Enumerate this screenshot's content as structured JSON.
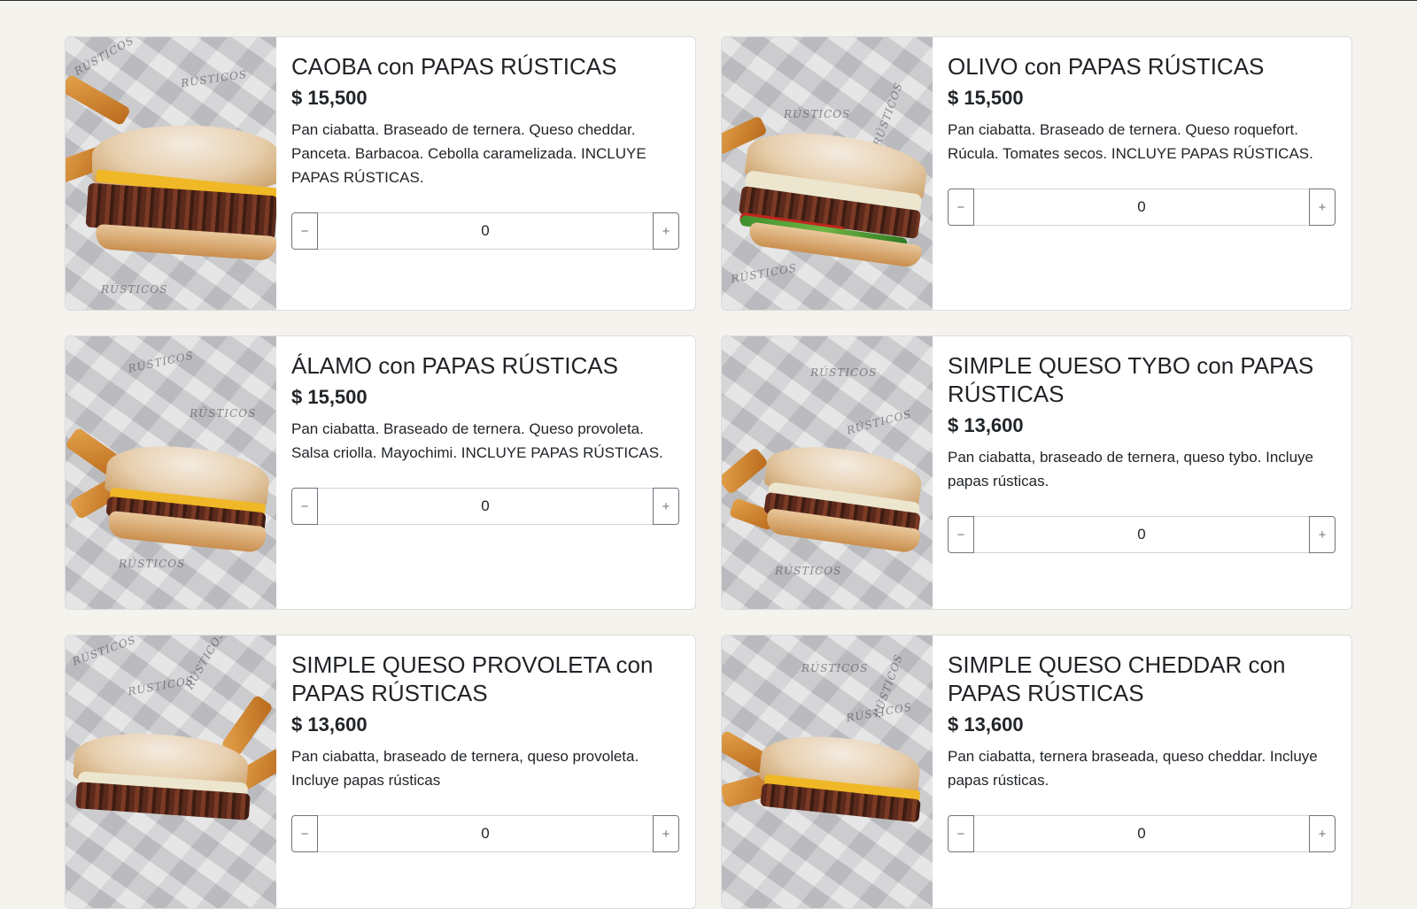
{
  "currency_symbol": "$",
  "products": [
    {
      "title": "CAOBA con PAPAS RÚSTICAS",
      "price": "$ 15,500",
      "description": "Pan ciabatta. Braseado de ternera. Queso cheddar. Panceta. Barbacoa. Cebolla caramelizada. INCLUYE PAPAS RÚSTICAS.",
      "quantity": "0",
      "minus_label": "−",
      "plus_label": "+"
    },
    {
      "title": "OLIVO con PAPAS RÚSTICAS",
      "price": "$ 15,500",
      "description": "Pan ciabatta. Braseado de ternera. Queso roquefort. Rúcula. Tomates secos. INCLUYE PAPAS RÚSTICAS.",
      "quantity": "0",
      "minus_label": "−",
      "plus_label": "+"
    },
    {
      "title": "ÁLAMO con PAPAS RÚSTICAS",
      "price": "$ 15,500",
      "description": "Pan ciabatta. Braseado de ternera. Queso provoleta. Salsa criolla. Mayochimi. INCLUYE PAPAS RÚSTICAS.",
      "quantity": "0",
      "minus_label": "−",
      "plus_label": "+"
    },
    {
      "title": "SIMPLE QUESO TYBO con PAPAS RÚSTICAS",
      "price": "$ 13,600",
      "description": "Pan ciabatta, braseado de ternera, queso tybo. Incluye papas rústicas.",
      "quantity": "0",
      "minus_label": "−",
      "plus_label": "+"
    },
    {
      "title": "SIMPLE QUESO PROVOLETA con PAPAS RÚSTICAS",
      "price": "$ 13,600",
      "description": "Pan ciabatta, braseado de ternera, queso provoleta. Incluye papas rústicas",
      "quantity": "0",
      "minus_label": "−",
      "plus_label": "+"
    },
    {
      "title": "SIMPLE QUESO CHEDDAR con PAPAS RÚSTICAS",
      "price": "$ 13,600",
      "description": "Pan ciabatta, ternera braseada, queso cheddar. Incluye papas rústicas.",
      "quantity": "0",
      "minus_label": "−",
      "plus_label": "+"
    }
  ],
  "wrapper_print": "RÚSTICOS"
}
